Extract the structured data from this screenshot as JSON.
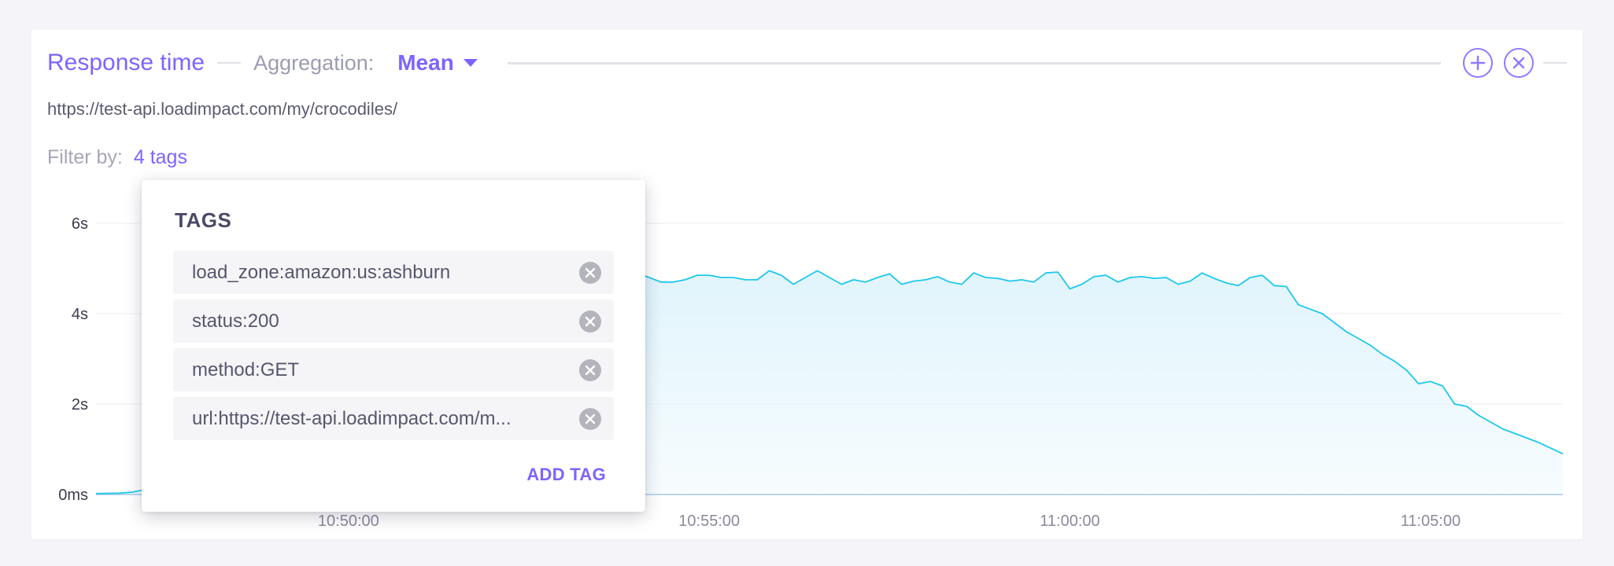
{
  "panel": {
    "title": "Response time",
    "aggregation_label": "Aggregation:",
    "aggregation_value": "Mean",
    "url": "https://test-api.loadimpact.com/my/crocodiles/",
    "filter_label": "Filter by:",
    "filter_value": "4 tags"
  },
  "icons": {
    "add": "plus-circle-icon",
    "close": "close-circle-icon",
    "dropdown": "caret-down-icon",
    "tag_remove": "close-circle-filled-icon"
  },
  "colors": {
    "accent": "#7d64ff",
    "series_line": "#1ec8ec",
    "series_fill": "#dff4fc"
  },
  "tags_popup": {
    "title": "TAGS",
    "tags": [
      {
        "label": "load_zone:amazon:us:ashburn"
      },
      {
        "label": "status:200"
      },
      {
        "label": "method:GET"
      },
      {
        "label": "url:https://test-api.loadimpact.com/m..."
      }
    ],
    "add_label": "ADD TAG"
  },
  "chart_data": {
    "type": "area",
    "title": "Response time",
    "xlabel": "",
    "ylabel": "",
    "ylim": [
      0,
      6
    ],
    "y_unit": "s",
    "y_ticks": [
      {
        "value": 0,
        "label": "0ms"
      },
      {
        "value": 2,
        "label": "2s"
      },
      {
        "value": 4,
        "label": "4s"
      },
      {
        "value": 6,
        "label": "6s"
      }
    ],
    "x_ticks": [
      {
        "value": "10:50:00",
        "label": "10:50:00"
      },
      {
        "value": "10:55:00",
        "label": "10:55:00"
      },
      {
        "value": "11:00:00",
        "label": "11:00:00"
      },
      {
        "value": "11:05:00",
        "label": "11:05:00"
      }
    ],
    "x_range": [
      "10:46:30",
      "11:06:50"
    ],
    "grid": true,
    "series": [
      {
        "x": [
          "10:46:30",
          "10:46:50",
          "10:47:00",
          "10:47:10",
          "10:47:30",
          "10:48:00",
          "10:48:30",
          "10:49:00",
          "10:49:30",
          "10:50:00",
          "10:50:30",
          "10:51:00",
          "10:51:30",
          "10:52:00",
          "10:52:30",
          "10:53:00",
          "10:53:30",
          "10:54:00",
          "10:54:10",
          "10:54:20",
          "10:54:30",
          "10:54:40",
          "10:54:50",
          "10:55:00",
          "10:55:10",
          "10:55:20",
          "10:55:30",
          "10:55:40",
          "10:55:50",
          "10:56:00",
          "10:56:10",
          "10:56:20",
          "10:56:30",
          "10:56:40",
          "10:56:50",
          "10:57:00",
          "10:57:10",
          "10:57:20",
          "10:57:30",
          "10:57:40",
          "10:57:50",
          "10:58:00",
          "10:58:10",
          "10:58:20",
          "10:58:30",
          "10:58:40",
          "10:58:50",
          "10:59:00",
          "10:59:10",
          "10:59:20",
          "10:59:30",
          "10:59:40",
          "10:59:50",
          "11:00:00",
          "11:00:10",
          "11:00:20",
          "11:00:30",
          "11:00:40",
          "11:00:50",
          "11:01:00",
          "11:01:10",
          "11:01:20",
          "11:01:30",
          "11:01:40",
          "11:01:50",
          "11:02:00",
          "11:02:10",
          "11:02:20",
          "11:02:30",
          "11:02:40",
          "11:02:50",
          "11:03:00",
          "11:03:10",
          "11:03:20",
          "11:03:30",
          "11:03:40",
          "11:03:50",
          "11:04:00",
          "11:04:10",
          "11:04:20",
          "11:04:30",
          "11:04:40",
          "11:04:50",
          "11:05:00",
          "11:05:10",
          "11:05:20",
          "11:05:30",
          "11:05:40",
          "11:05:50",
          "11:06:00",
          "11:06:10",
          "11:06:20",
          "11:06:30",
          "11:06:50"
        ],
        "values": [
          0.02,
          0.03,
          0.05,
          0.1,
          0.25,
          0.8,
          1.8,
          3.0,
          3.9,
          4.4,
          4.6,
          4.7,
          4.75,
          4.8,
          4.85,
          4.9,
          4.85,
          4.9,
          4.8,
          4.7,
          4.7,
          4.75,
          4.85,
          4.85,
          4.8,
          4.8,
          4.75,
          4.75,
          4.95,
          4.85,
          4.65,
          4.8,
          4.95,
          4.8,
          4.65,
          4.75,
          4.7,
          4.8,
          4.88,
          4.65,
          4.72,
          4.75,
          4.82,
          4.7,
          4.65,
          4.9,
          4.8,
          4.78,
          4.72,
          4.75,
          4.7,
          4.9,
          4.92,
          4.55,
          4.65,
          4.82,
          4.85,
          4.7,
          4.8,
          4.82,
          4.78,
          4.8,
          4.65,
          4.72,
          4.9,
          4.78,
          4.68,
          4.62,
          4.8,
          4.85,
          4.62,
          4.6,
          4.2,
          4.1,
          4.0,
          3.8,
          3.6,
          3.45,
          3.3,
          3.1,
          2.95,
          2.75,
          2.45,
          2.5,
          2.4,
          2.0,
          1.95,
          1.75,
          1.6,
          1.45,
          1.35,
          1.25,
          1.15,
          0.9
        ]
      }
    ]
  }
}
